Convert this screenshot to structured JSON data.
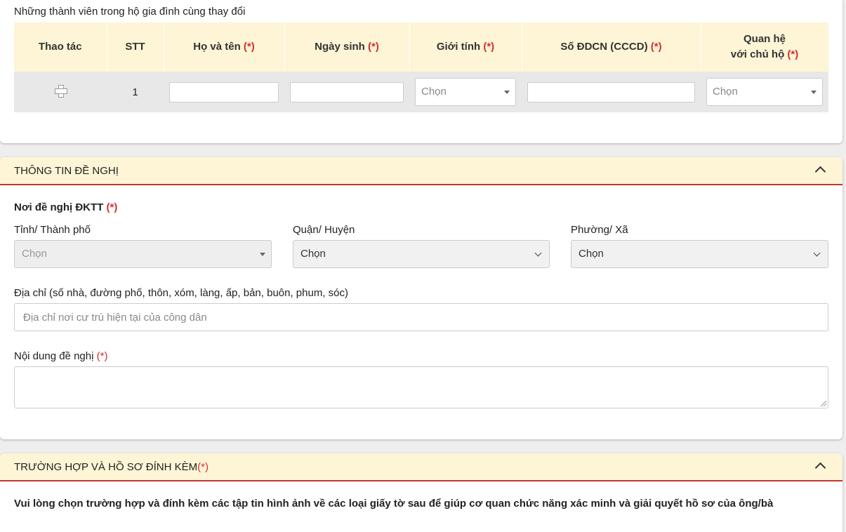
{
  "members": {
    "title": "Những thành viên trong hộ gia đình cùng thay đổi",
    "headers": {
      "action": "Thao tác",
      "stt": "STT",
      "name": "Họ và tên",
      "dob": "Ngày sinh",
      "gender": "Giới tính",
      "id_number": "Số ĐDCN (CCCD)",
      "relation_line1": "Quan hệ",
      "relation_line2": "với chủ hộ",
      "required_mark": "(*)"
    },
    "rows": [
      {
        "stt": "1",
        "name": "",
        "dob": "",
        "gender": "Chọn",
        "id_number": "",
        "relation": "Chọn"
      }
    ]
  },
  "proposal": {
    "header": "THÔNG TIN ĐỀ NGHỊ",
    "location_label": "Nơi đề nghị ĐKTT",
    "required_mark": "(*)",
    "province_label": "Tỉnh/ Thành phố",
    "province_value": "Chọn",
    "district_label": "Quận/ Huyện",
    "district_value": "Chọn",
    "ward_label": "Phường/ Xã",
    "ward_value": "Chọn",
    "address_label": "Địa chỉ (số nhà, đường phố, thôn, xóm, làng, ấp, bản, buôn, phum, sóc)",
    "address_placeholder": "Địa chỉ nơi cư trú hiện tại của công dân",
    "content_label": "Nội dung đề nghị"
  },
  "attachments": {
    "header": "TRƯỜNG HỢP VÀ HỒ SƠ ĐÍNH KÈM",
    "required_mark": "(*)",
    "instruction": "Vui lòng chọn trường hợp và đính kèm các tập tin hình ảnh về các loại giấy tờ sau để giúp cơ quan chức năng xác minh và giải quyết hồ sơ của ông/bà"
  },
  "colors": {
    "header_bg": "#fdf5d6",
    "required": "#d32f2f",
    "header_border": "#c0392b"
  }
}
